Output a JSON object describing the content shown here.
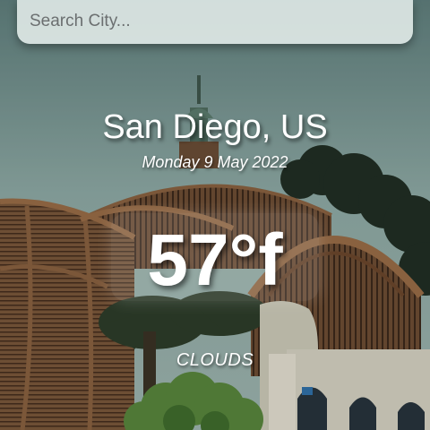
{
  "search": {
    "placeholder": "Search City..."
  },
  "weather": {
    "location": "San Diego, US",
    "date": "Monday 9 May 2022",
    "temperature": "57°f",
    "condition": "CLOUDS"
  }
}
